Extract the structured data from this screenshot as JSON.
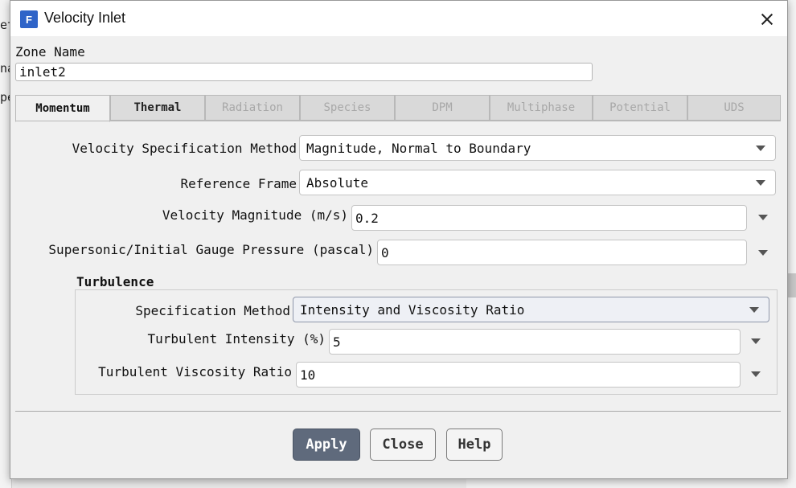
{
  "background": {
    "frag_1": "et",
    "frag_2": "na",
    "frag_3": "pe"
  },
  "dialog": {
    "title": "Velocity Inlet",
    "app_icon": "F"
  },
  "zone": {
    "label": "Zone Name",
    "value": "inlet2"
  },
  "tabs": [
    {
      "label": "Momentum",
      "state": "active"
    },
    {
      "label": "Thermal",
      "state": "enabled"
    },
    {
      "label": "Radiation",
      "state": "disabled"
    },
    {
      "label": "Species",
      "state": "disabled"
    },
    {
      "label": "DPM",
      "state": "disabled"
    },
    {
      "label": "Multiphase",
      "state": "disabled"
    },
    {
      "label": "Potential",
      "state": "disabled"
    },
    {
      "label": "UDS",
      "state": "disabled"
    }
  ],
  "momentum": {
    "velocity_spec": {
      "label": "Velocity Specification Method",
      "value": "Magnitude, Normal to Boundary"
    },
    "reference_frame": {
      "label": "Reference Frame",
      "value": "Absolute"
    },
    "velocity_magnitude": {
      "label": "Velocity Magnitude (m/s)",
      "value": "0.2"
    },
    "gauge_pressure": {
      "label": "Supersonic/Initial Gauge Pressure (pascal)",
      "value": "0"
    }
  },
  "turbulence": {
    "title": "Turbulence",
    "spec_method": {
      "label": "Specification Method",
      "value": "Intensity and Viscosity Ratio"
    },
    "intensity": {
      "label": "Turbulent Intensity (%)",
      "value": "5"
    },
    "viscosity_ratio": {
      "label": "Turbulent Viscosity Ratio",
      "value": "10"
    }
  },
  "buttons": {
    "apply": "Apply",
    "close": "Close",
    "help": "Help"
  },
  "colors": {
    "accent": "#5f6a7c",
    "app_icon": "#2f64c8"
  }
}
